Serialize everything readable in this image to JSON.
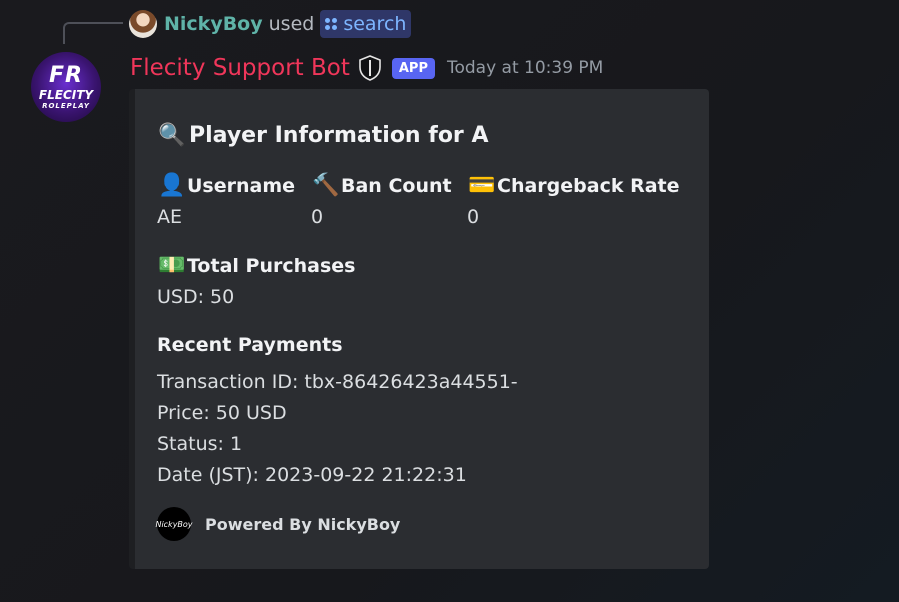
{
  "reply": {
    "user": "NickyBoy",
    "used": "used",
    "command": "search"
  },
  "bot": {
    "avatar_line1": "FR",
    "avatar_line2": "FLECITY",
    "avatar_line3": "ROLEPLAY",
    "name": "Flecity Support Bot",
    "badge": "APP",
    "timestamp": "Today at 10:39 PM"
  },
  "embed": {
    "title": "Player Information for A",
    "fields": [
      {
        "icon": "👤",
        "name": "Username",
        "value": "AE"
      },
      {
        "icon": "🔨",
        "name": "Ban Count",
        "value": "0"
      },
      {
        "icon": "💳",
        "name": "Chargeback Rate",
        "value": "0"
      }
    ],
    "purchases": {
      "icon": "💵",
      "name": "Total Purchases",
      "value": "USD: 50"
    },
    "recent": {
      "name": "Recent Payments",
      "lines": [
        "Transaction ID: tbx-86426423a44551-",
        "Price: 50 USD",
        "Status: 1",
        "Date (JST): 2023-09-22 21:22:31"
      ]
    },
    "footer": {
      "icon_text": "NickyBoy",
      "text": "Powered By NickyBoy"
    }
  },
  "colors": {
    "bot_name": "#f0365a",
    "reply_user": "#5fb3a8",
    "app_badge": "#5865f2",
    "embed_bg": "#2b2d31"
  }
}
